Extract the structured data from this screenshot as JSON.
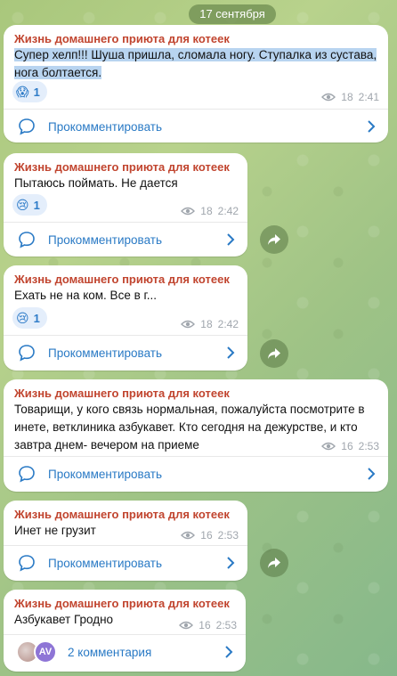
{
  "date_label": "17 сентября",
  "channel_name": "Жизнь домашнего приюта для котеек",
  "comment_label": "Прокомментировать",
  "messages": [
    {
      "text_lines": [
        "Супер хелп!!! Шуша пришла, сломала ногу. Ступалка из сустава,",
        "нога болтается."
      ],
      "reaction": {
        "emoji": "😱",
        "count": "1"
      },
      "views": "18",
      "time": "2:41"
    },
    {
      "text_lines": [
        "Пытаюсь поймать. Не дается"
      ],
      "reaction": {
        "emoji": "😢",
        "count": "1"
      },
      "views": "18",
      "time": "2:42"
    },
    {
      "text_lines": [
        "Ехать не на ком. Все в г..."
      ],
      "reaction": {
        "emoji": "😢",
        "count": "1"
      },
      "views": "18",
      "time": "2:42"
    },
    {
      "text_lines": [
        "Товарищи, у кого связь нормальная, пожалуйста посмотрите в",
        "инете, ветклиника азбукавет. Кто сегодня на дежурстве, и кто",
        "завтра днем- вечером на приеме"
      ],
      "views": "16",
      "time": "2:53"
    },
    {
      "text_lines": [
        "Инет не грузит"
      ],
      "views": "16",
      "time": "2:53"
    },
    {
      "text_lines": [
        "Азбукавет Гродно"
      ],
      "views": "16",
      "time": "2:53",
      "comments_label": "2 комментария",
      "avatar_initials": "AV"
    }
  ],
  "icons": [
    "eye-icon",
    "comment-icon",
    "chevron-right-icon",
    "share-icon"
  ]
}
